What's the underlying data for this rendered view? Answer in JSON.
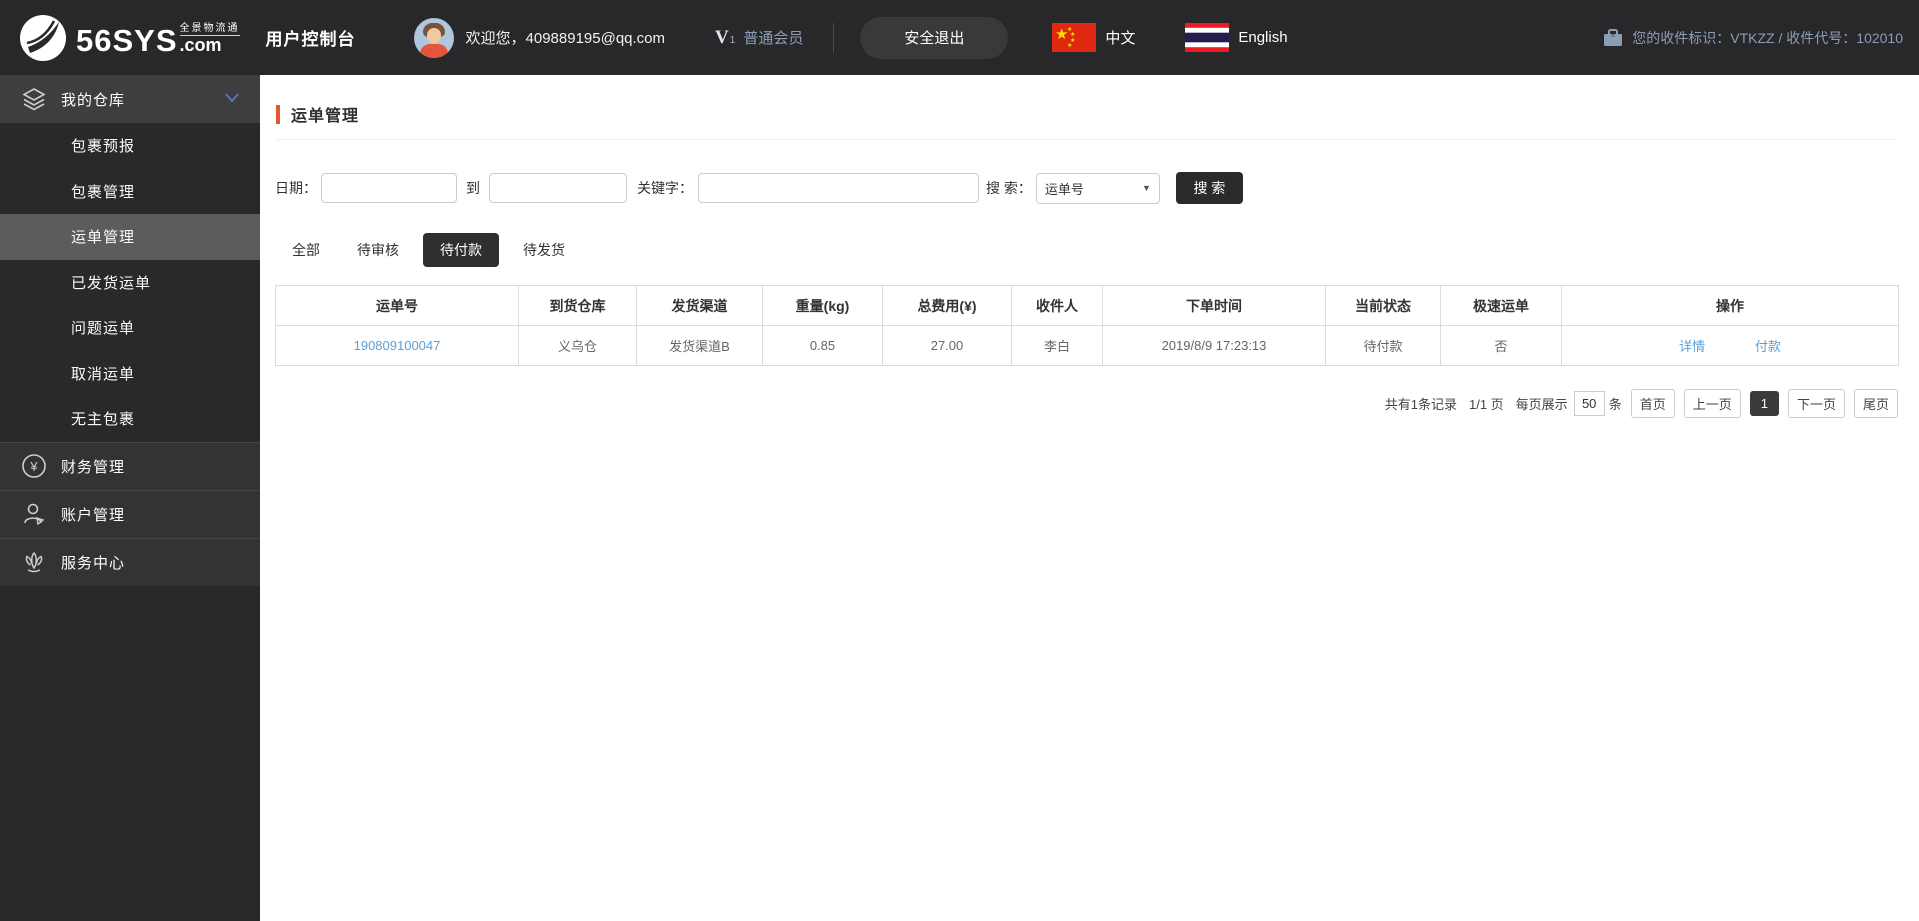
{
  "header": {
    "brand": "56SYS",
    "brand_suffix": ".com",
    "brand_tagline": "全景物流通",
    "console_title": "用户控制台",
    "welcome": "欢迎您，409889195@qq.com",
    "member_v": "V",
    "member_v_sub": "1",
    "member_label": "普通会员",
    "logout_label": "安全退出",
    "lang_zh": "中文",
    "lang_en": "English",
    "receiver_info": "您的收件标识：VTKZZ / 收件代号：102010"
  },
  "sidebar": {
    "warehouse_label": "我的仓库",
    "submenu": [
      {
        "label": "包裹预报"
      },
      {
        "label": "包裹管理"
      },
      {
        "label": "运单管理"
      },
      {
        "label": "已发货运单"
      },
      {
        "label": "问题运单"
      },
      {
        "label": "取消运单"
      },
      {
        "label": "无主包裹"
      }
    ],
    "finance_label": "财务管理",
    "account_label": "账户管理",
    "service_label": "服务中心"
  },
  "main": {
    "page_title": "运单管理",
    "filters": {
      "date_label": "日期：",
      "to_label": "到",
      "keyword_label": "关键字：",
      "search_label": "搜 索：",
      "search_type_selected": "运单号",
      "search_button": "搜 索"
    },
    "tabs": [
      {
        "label": "全部"
      },
      {
        "label": "待审核"
      },
      {
        "label": "待付款"
      },
      {
        "label": "待发货"
      }
    ],
    "table": {
      "headers": [
        "运单号",
        "到货仓库",
        "发货渠道",
        "重量(kg)",
        "总费用(¥)",
        "收件人",
        "下单时间",
        "当前状态",
        "极速运单",
        "操作"
      ],
      "rows": [
        {
          "waybill_no": "190809100047",
          "warehouse": "义乌仓",
          "channel": "发货渠道B",
          "weight": "0.85",
          "total_fee": "27.00",
          "receiver": "李白",
          "order_time": "2019/8/9 17:23:13",
          "status": "待付款",
          "express": "否",
          "action_detail": "详情",
          "action_pay": "付款"
        }
      ]
    },
    "pagination": {
      "total_text": "共有1条记录",
      "page_text": "1/1 页",
      "per_page_prefix": "每页展示",
      "per_page_value": "50",
      "per_page_suffix": "条",
      "first": "首页",
      "prev": "上一页",
      "current": "1",
      "next": "下一页",
      "last": "尾页"
    }
  },
  "colors": {
    "accent_orange": "#e8552e",
    "link_blue": "#58a0dc",
    "header_bg": "#28282a",
    "muted_blue_text": "#8b9db5"
  }
}
